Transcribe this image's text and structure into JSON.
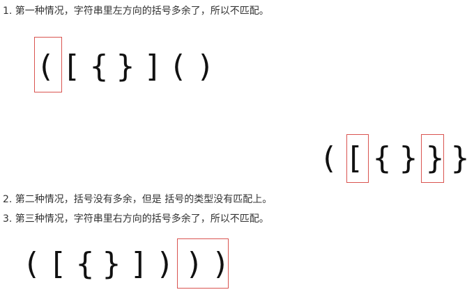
{
  "case1": {
    "caption": "1. 第一种情况，字符串里左方向的括号多余了，所以不匹配。",
    "brackets": [
      "(",
      "[",
      "{",
      "}",
      "]",
      "(",
      ")"
    ]
  },
  "case2": {
    "caption": "2. 第二种情况，括号没有多余，但是 括号的类型没有匹配上。",
    "brackets": [
      "(",
      "[",
      "{",
      "}",
      "}",
      "}"
    ]
  },
  "case3": {
    "caption": "3. 第三种情况，字符串里右方向的括号多余了，所以不匹配。",
    "brackets": [
      "(",
      "[",
      "{",
      "}",
      "]",
      ")",
      ")",
      ")"
    ]
  },
  "colors": {
    "highlight_box": "#d9534f",
    "text": "#333333"
  }
}
